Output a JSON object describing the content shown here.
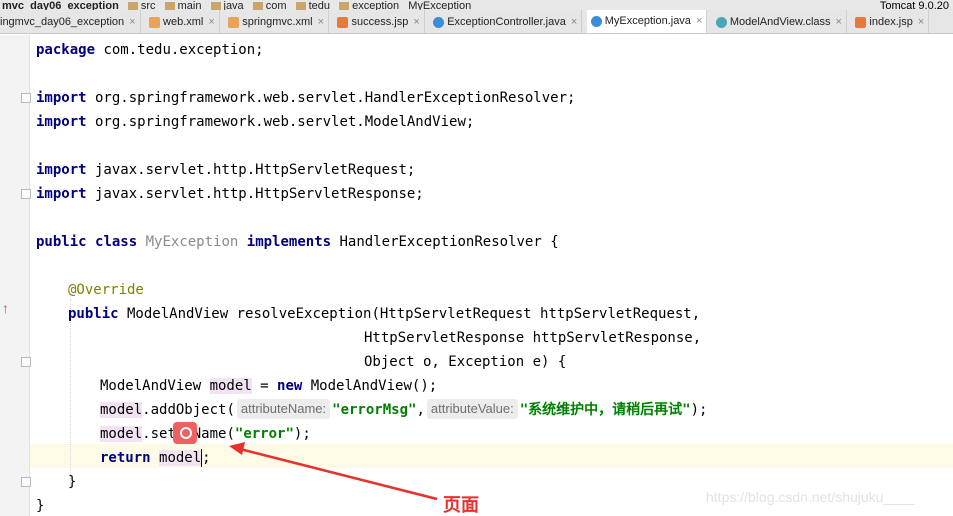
{
  "breadcrumb": {
    "project": "mvc_day06_exception",
    "items": [
      "src",
      "main",
      "java",
      "com",
      "tedu",
      "exception",
      "MyException"
    ]
  },
  "run_config": {
    "label": "Tomcat 9.0.20"
  },
  "tabs": [
    {
      "label": "ingmvc_day06_exception",
      "icon": "project-icon",
      "active": false
    },
    {
      "label": "web.xml",
      "icon": "xml-file-icon",
      "active": false
    },
    {
      "label": "springmvc.xml",
      "icon": "xml-file-icon",
      "active": false
    },
    {
      "label": "success.jsp",
      "icon": "jsp-file-icon",
      "active": false
    },
    {
      "label": "ExceptionController.java",
      "icon": "java-class-icon",
      "active": false
    },
    {
      "label": "MyException.java",
      "icon": "java-class-icon",
      "active": true
    },
    {
      "label": "ModelAndView.class",
      "icon": "class-file-icon",
      "active": false
    },
    {
      "label": "index.jsp",
      "icon": "jsp-file-icon",
      "active": false
    }
  ],
  "code": {
    "package_kw": "package",
    "package_name": " com.tedu.exception;",
    "import_kw": "import",
    "imports": [
      " org.springframework.web.servlet.HandlerExceptionResolver;",
      " org.springframework.web.servlet.ModelAndView;",
      " javax.servlet.http.HttpServletRequest;",
      " javax.servlet.http.HttpServletResponse;"
    ],
    "public_kw": "public",
    "class_kw": "class",
    "class_name": "MyException",
    "implements_kw": "implements",
    "interface_decl": " HandlerExceptionResolver {",
    "annotation": "@Override",
    "method_sig": " ModelAndView resolveException(HttpServletRequest httpServletRequest,",
    "param2": "HttpServletResponse httpServletResponse,",
    "param3": "Object o, Exception e) {",
    "decl_type": "ModelAndView ",
    "var": "model",
    "decl_rest": " = ",
    "new_kw": "new",
    "decl_end": " ModelAndView();",
    "add_call": ".addObject(",
    "hint_name": "attributeName:",
    "arg1": "\"errorMsg\"",
    "comma": ",",
    "hint_value": "attributeValue:",
    "arg2": "\"系统维护中，请稍后再试\"",
    "call_end": ");",
    "set_prefix": ".set",
    "set_suffix": "Name(",
    "view_arg": "\"error\"",
    "return_kw": "return",
    "semicolon": ";",
    "close_method": "}",
    "close_class": "}"
  },
  "annotation_text": "页面",
  "watermark": "https://blog.csdn.net/shujuku____"
}
